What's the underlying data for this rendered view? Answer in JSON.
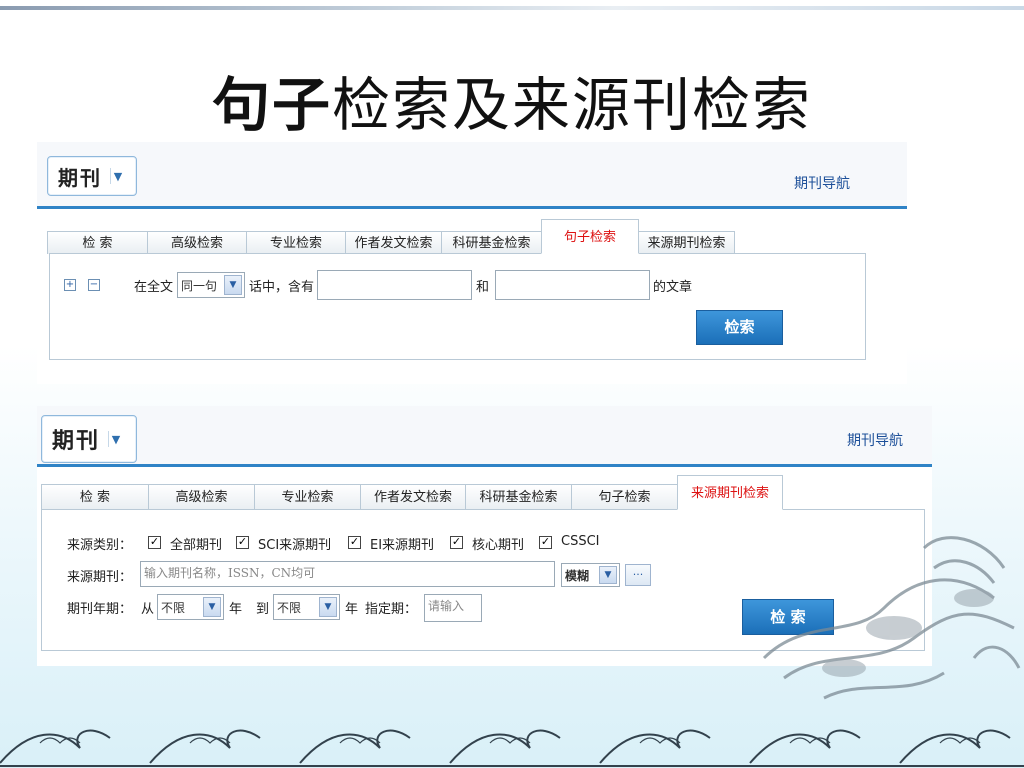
{
  "slide": {
    "title_bold": "句子",
    "title_rest": "检索及来源刊检索"
  },
  "panel1": {
    "dropdown_label": "期刊",
    "nav_link": "期刊导航",
    "tabs": [
      "检 索",
      "高级检索",
      "专业检索",
      "作者发文检索",
      "科研基金检索",
      "句子检索",
      "来源期刊检索"
    ],
    "active_tab": 5,
    "scope_label": "在全文",
    "scope_select": "同一句",
    "contains_label": "话中，含有",
    "and_label": "和",
    "suffix_label": "的文章",
    "search_button": "检索"
  },
  "panel2": {
    "dropdown_label": "期刊",
    "nav_link": "期刊导航",
    "tabs": [
      "检 索",
      "高级检索",
      "专业检索",
      "作者发文检索",
      "科研基金检索",
      "句子检索",
      "来源期刊检索"
    ],
    "active_tab": 6,
    "category_label": "来源类别：",
    "categories": [
      "全部期刊",
      "SCI来源期刊",
      "EI来源期刊",
      "核心期刊",
      "CSSCI"
    ],
    "journal_label": "来源期刊：",
    "journal_placeholder": "输入期刊名称，ISSN，CN均可",
    "match_select": "模糊",
    "year_label": "期刊年期：",
    "from_label": "从",
    "from_select": "不限",
    "year_unit": "年",
    "to_label": "到",
    "to_select": "不限",
    "year_unit2": "年",
    "issue_label": "指定期：",
    "issue_placeholder": "请输入",
    "search_button": "检 索"
  }
}
